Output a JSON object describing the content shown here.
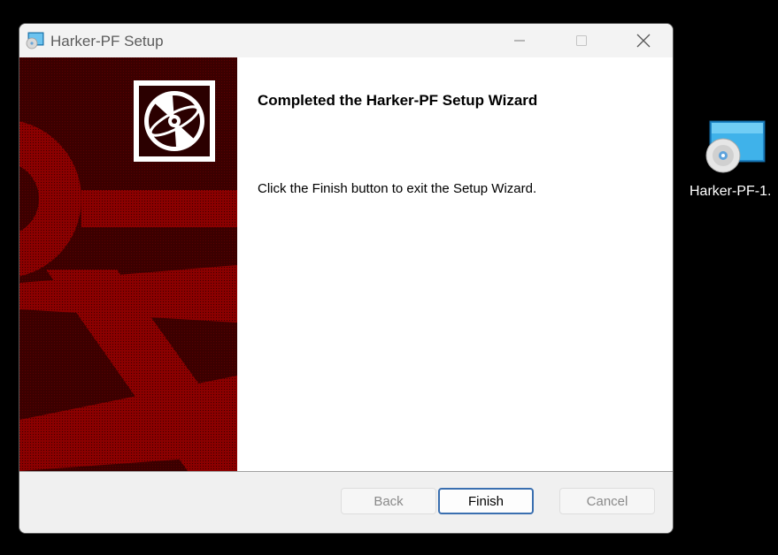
{
  "window": {
    "title": "Harker-PF Setup"
  },
  "wizard": {
    "heading": "Completed the Harker-PF Setup Wizard",
    "message": "Click the Finish button to exit the Setup Wizard."
  },
  "buttons": {
    "back": "Back",
    "finish": "Finish",
    "cancel": "Cancel"
  },
  "desktop": {
    "icon_label": "Harker-PF-1."
  },
  "colors": {
    "banner_dark": "#3a0000",
    "banner_red": "#8b0000",
    "finish_border": "#3a6fb0"
  },
  "icons": {
    "app": "installer-disc-icon",
    "banner_logo": "cd-disc-icon",
    "minimize": "minimize-icon",
    "maximize": "maximize-icon",
    "close": "close-icon",
    "desktop": "msi-installer-icon"
  }
}
